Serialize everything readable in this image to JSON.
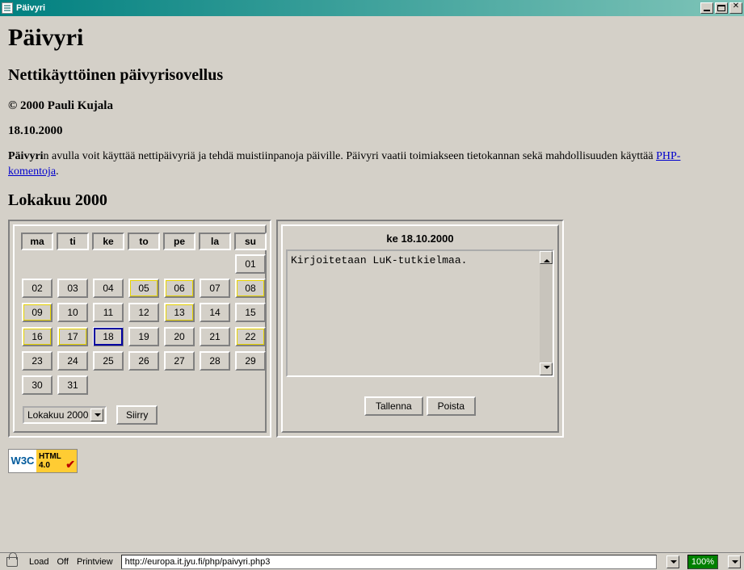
{
  "window": {
    "title": "Päivyri"
  },
  "page": {
    "title": "Päivyri",
    "subtitle": "Nettikäyttöinen päivyrisovellus",
    "copyright": "© 2000 Pauli Kujala",
    "date": "18.10.2000",
    "desc_prefix_bold": "Päivyri",
    "desc_text": "n avulla voit käyttää nettipäivyriä ja tehdä muistiinpanoja päiville. Päivyri vaatii toimiakseen tietokannan sekä mahdollisuuden käyttää ",
    "desc_link": "PHP-komentoja",
    "desc_suffix": ".",
    "month_heading": "Lokakuu 2000"
  },
  "calendar": {
    "weekdays": [
      "ma",
      "ti",
      "ke",
      "to",
      "pe",
      "la",
      "su"
    ],
    "rows": [
      [
        "",
        "",
        "",
        "",
        "",
        "",
        "01"
      ],
      [
        "02",
        "03",
        "04",
        "05",
        "06",
        "07",
        "08"
      ],
      [
        "09",
        "10",
        "11",
        "12",
        "13",
        "14",
        "15"
      ],
      [
        "16",
        "17",
        "18",
        "19",
        "20",
        "21",
        "22"
      ],
      [
        "23",
        "24",
        "25",
        "26",
        "27",
        "28",
        "29"
      ],
      [
        "30",
        "31",
        "",
        "",
        "",
        "",
        ""
      ]
    ],
    "highlight_yellow": [
      "05",
      "06",
      "08",
      "09",
      "13",
      "16",
      "17",
      "22"
    ],
    "highlight_blue": [
      "18"
    ],
    "month_select": "Lokakuu 2000",
    "go_label": "Siirry"
  },
  "note": {
    "title": "ke 18.10.2000",
    "text": "Kirjoitetaan LuK-tutkielmaa.",
    "save_label": "Tallenna",
    "delete_label": "Poista"
  },
  "badge": {
    "left": "W3C",
    "right_top": "HTML",
    "right_bottom": "4.0",
    "check": "✔"
  },
  "status": {
    "load": "Load",
    "off": "Off",
    "printview": "Printview",
    "url": "http://europa.it.jyu.fi/php/paivyri.php3",
    "zoom": "100%"
  }
}
